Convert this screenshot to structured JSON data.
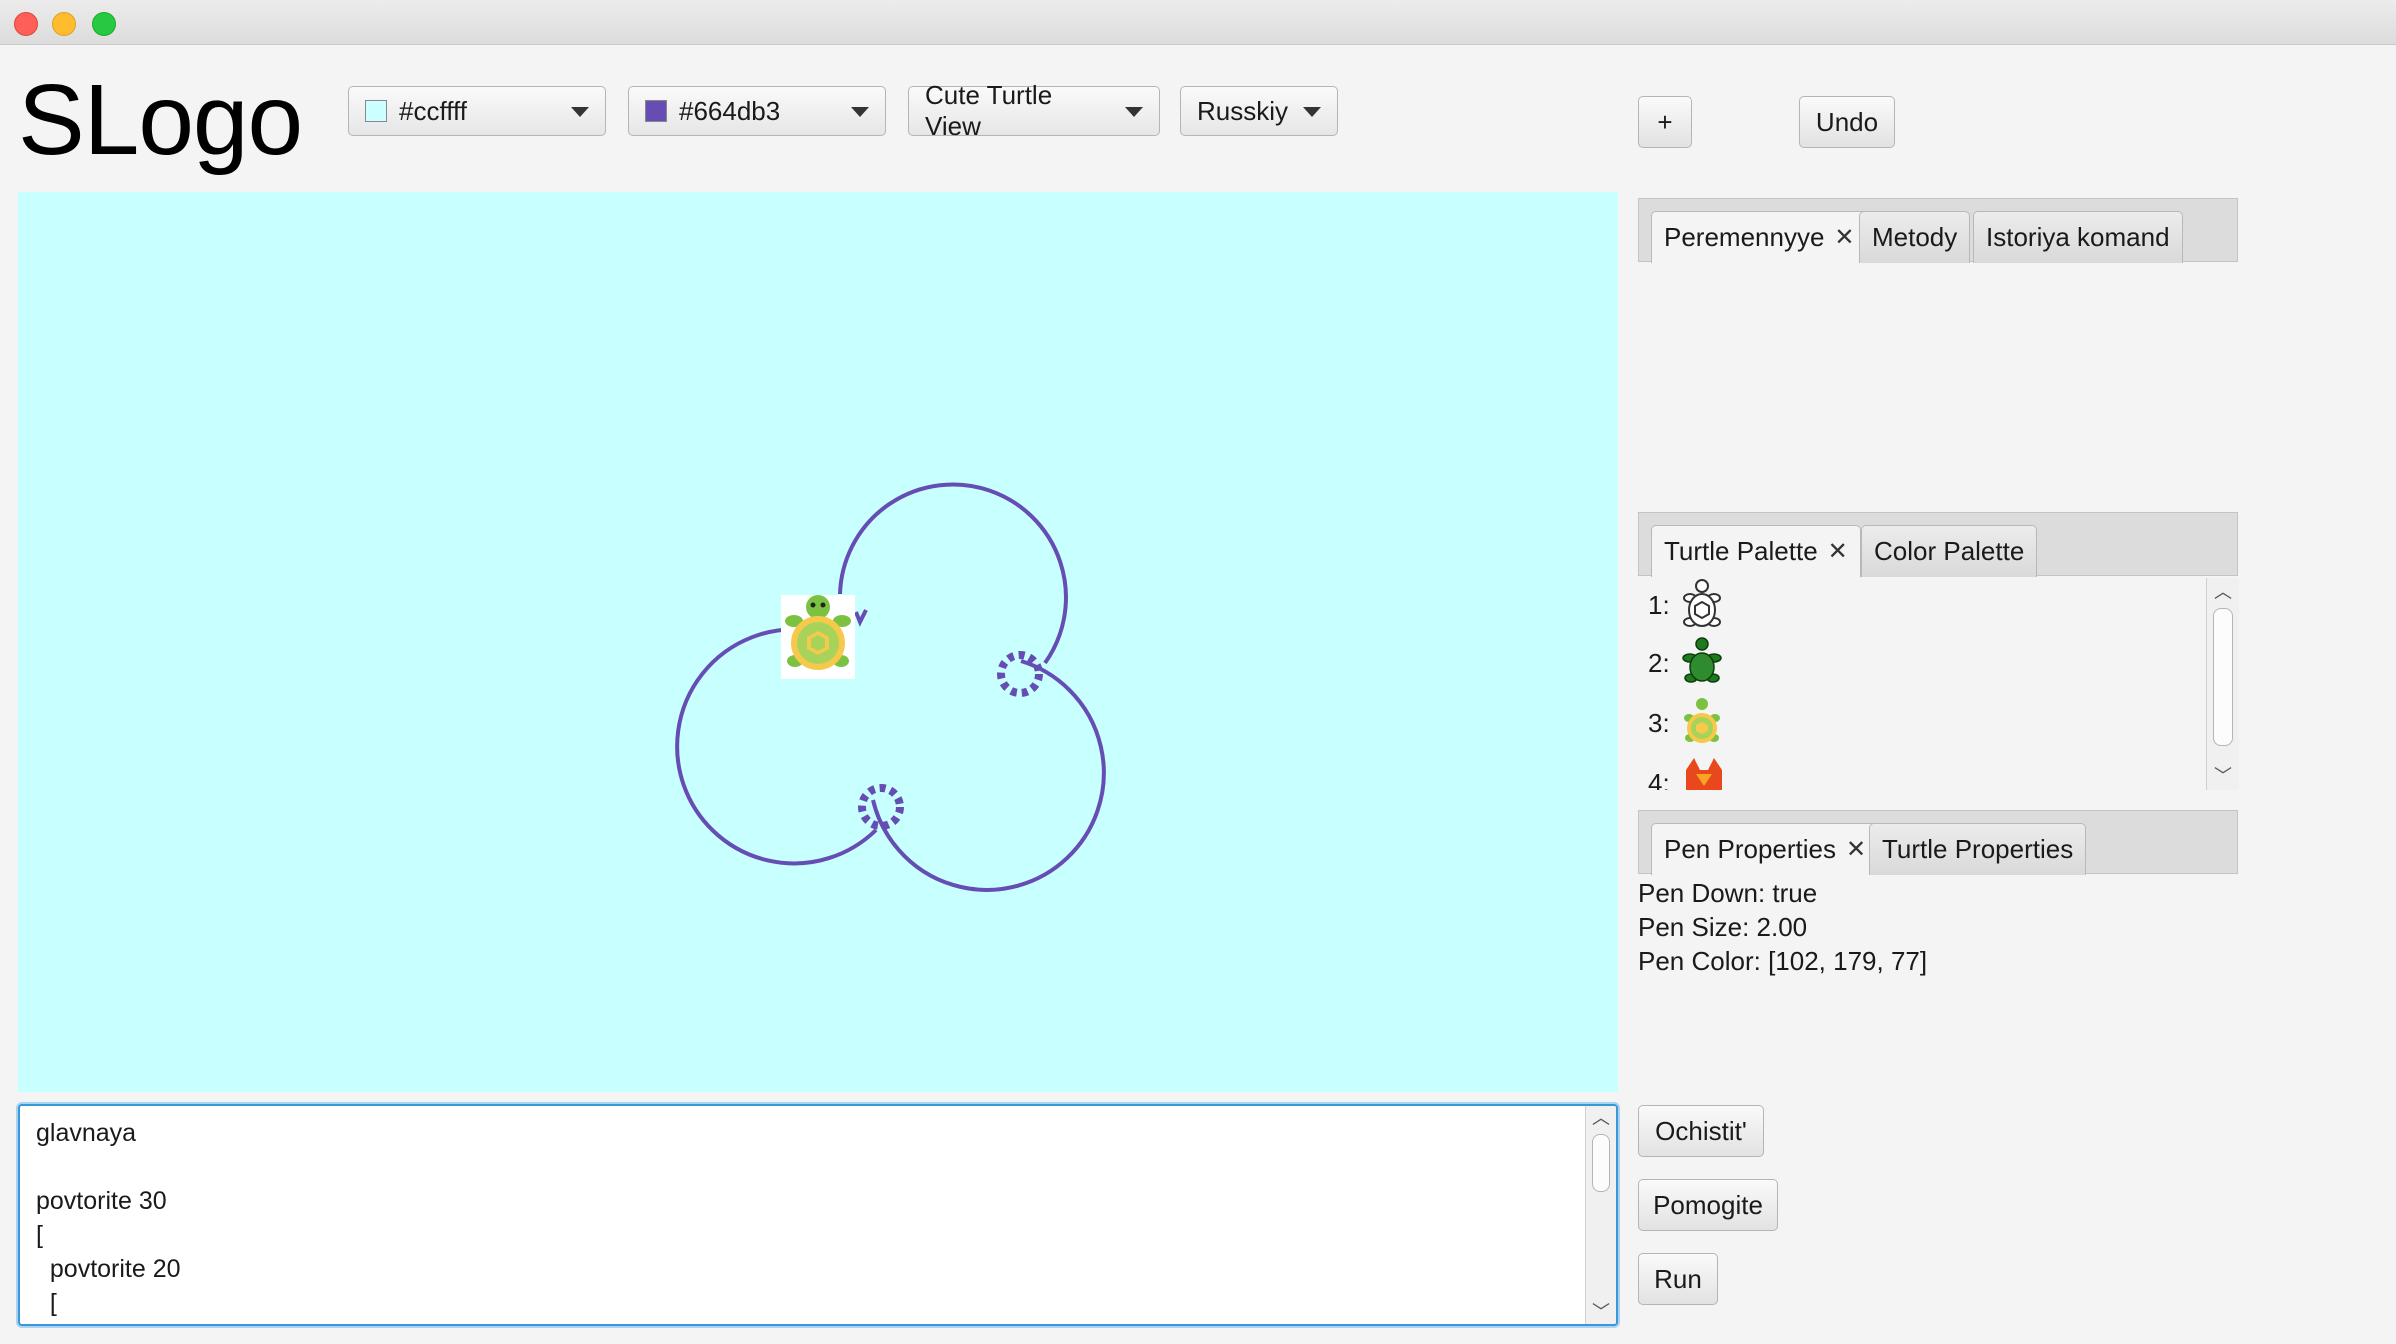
{
  "window": {
    "title_buttons": [
      "close",
      "minimize",
      "zoom"
    ]
  },
  "app": {
    "logo": "SLogo"
  },
  "toolbar": {
    "bg_color": {
      "label": "#ccffff",
      "swatch": "#ccffff"
    },
    "pen_color": {
      "label": "#664db3",
      "swatch": "#664db3"
    },
    "view": "Cute Turtle View",
    "language": "Russkiy",
    "add_label": "+",
    "undo_label": "Undo"
  },
  "colors": {
    "canvas_bg": "#c8ffff",
    "pen": "#664db3",
    "focus": "#3a98d8"
  },
  "info_tabs": {
    "tabs": [
      {
        "label": "Peremennyye",
        "selected": true,
        "closable": true
      },
      {
        "label": "Metody",
        "selected": false,
        "closable": false
      },
      {
        "label": "Istoriya komand",
        "selected": false,
        "closable": false
      }
    ]
  },
  "palette_tabs": {
    "tabs": [
      {
        "label": "Turtle Palette",
        "selected": true,
        "closable": true
      },
      {
        "label": "Color Palette",
        "selected": false,
        "closable": false
      }
    ],
    "items": [
      {
        "num": "1:",
        "icon": "outline-turtle-icon"
      },
      {
        "num": "2:",
        "icon": "green-turtle-icon"
      },
      {
        "num": "3:",
        "icon": "cute-turtle-icon"
      },
      {
        "num": "4:",
        "icon": "fox-icon"
      }
    ]
  },
  "props_tabs": {
    "tabs": [
      {
        "label": "Pen Properties",
        "selected": true,
        "closable": true
      },
      {
        "label": "Turtle Properties",
        "selected": false,
        "closable": false
      }
    ],
    "pen_down": "Pen Down: true",
    "pen_size": "Pen Size: 2.00",
    "pen_color": "Pen Color: [102, 179, 77]"
  },
  "editor": {
    "text": "glavnaya\n\npovtorite 30\n[\n  povtorite 20\n  ["
  },
  "actions": {
    "clear": "Ochistit'",
    "help": "Pomogite",
    "run": "Run"
  }
}
